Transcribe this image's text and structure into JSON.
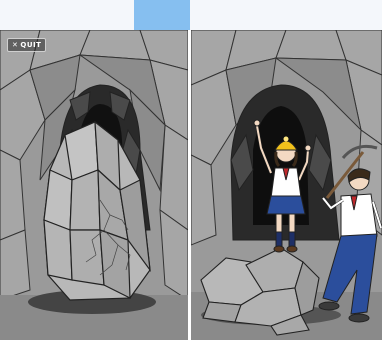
{
  "top_bar": {
    "colors": {
      "left": "#ffffff",
      "middle": "#86bff0",
      "right": "#ffffff"
    }
  },
  "quit_button": {
    "icon": "close-icon",
    "label": "QUIT"
  },
  "scenes": {
    "before": {
      "description_name": "cave-with-boulder",
      "background": "#8a8a8a"
    },
    "after": {
      "description_name": "cave-with-broken-boulder",
      "background": "#8a8a8a"
    }
  },
  "colors": {
    "rock_light": "#b9b9b9",
    "rock_mid": "#8f8f8f",
    "rock_dark": "#5c5c5c",
    "cave_dark": "#1c1c1c",
    "outline": "#222222",
    "shirt_blue": "#2b4e9c",
    "helmet_yellow": "#f2c21b",
    "tie_red": "#c0282b"
  }
}
